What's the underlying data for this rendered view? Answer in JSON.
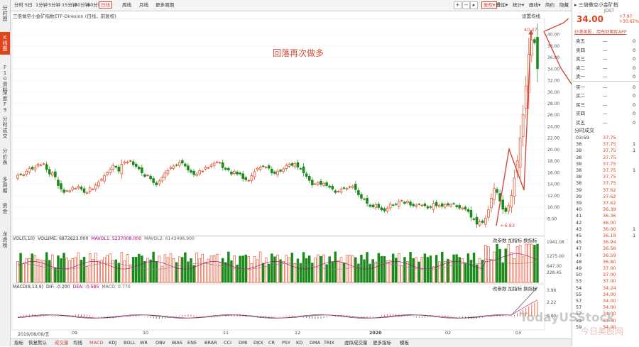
{
  "sidebar": [
    {
      "label": "分时图",
      "active": false
    },
    {
      "label": "K线图",
      "active": true
    },
    {
      "label": "F10资料",
      "active": false
    },
    {
      "label": "深度F9",
      "active": false
    },
    {
      "label": "分时成交",
      "active": false
    },
    {
      "label": "分价表",
      "active": false
    },
    {
      "label": "多周期",
      "active": false
    },
    {
      "label": "资金",
      "active": false
    },
    {
      "label": "龙虎榜",
      "active": false
    }
  ],
  "toolbar": {
    "periods": [
      "分时",
      "5日",
      "1分钟",
      "5分钟",
      "15分钟",
      "30分钟",
      "60分钟",
      "日线",
      "周线",
      "月线",
      "更多周期"
    ],
    "active_period": "日线",
    "nav_btns": [
      "+",
      "−",
      "▸"
    ],
    "fq": "复权",
    "right_items": [
      "叠加",
      "统计",
      "画线",
      "简约",
      "隐藏"
    ]
  },
  "chart": {
    "title": "三倍做空小金矿指数ETF-Direxion (日线，前复权)",
    "settings": "设置均线",
    "annotation": "回落再次做多",
    "high_label": "40.47",
    "low_label": "6.83",
    "y_ticks": [
      "40.00",
      "38.00",
      "36.00",
      "34.00",
      "32.00",
      "30.00",
      "28.00",
      "26.00",
      "24.00",
      "22.00",
      "20.00",
      "18.00",
      "16.00",
      "14.00",
      "12.00",
      "10.00",
      "8.00"
    ]
  },
  "volume": {
    "label": "VOL(5,10)",
    "volume": "VOLUME: 6872623.000",
    "ma1": "MAVOL1: 5237008.000",
    "ma2": "MAVOL2: 6143496.900",
    "ticks": [
      "1941.08",
      "1275.00",
      "647.00",
      "228.45"
    ],
    "buttons": [
      "改参数",
      "加指标",
      "换指标"
    ]
  },
  "macd": {
    "label": "MACD(8,13,9)",
    "dif": "DIF: -0.200",
    "dea": "DEA: -0.585",
    "macd": "MACD: 0.770",
    "ticks": [
      "3.96",
      "2.22",
      "0.00"
    ],
    "buttons": [
      "改参数",
      "加指标",
      "换指标"
    ]
  },
  "xaxis": [
    "2019/08/09/五",
    "09",
    "10",
    "11",
    "12",
    "2020",
    "02",
    "03"
  ],
  "bottom_tabs": [
    "指标",
    "恢复默认",
    "成交量",
    "均线",
    "MACD",
    "KDJ",
    "BOLL",
    "WR",
    "OBV",
    "BIAS",
    "ENE",
    "BRAR",
    "CCI",
    "DMI",
    "DKX",
    "CR",
    "PSY",
    "KD",
    "DMA",
    "TRIX",
    "虚拟成交量",
    "更多指标",
    "模板"
  ],
  "quote": {
    "name": "三倍做空小金矿指",
    "code": "JDST",
    "price": "34.00",
    "change": "+7.97",
    "change_pct": "+30.62%",
    "notice": "炒港美股，用东财国际APP",
    "sells": [
      "卖五",
      "卖四",
      "卖三",
      "卖二",
      "卖一"
    ],
    "buys": [
      "买一",
      "买二",
      "买三",
      "买四",
      "买五"
    ],
    "dash": "—",
    "zero": "0"
  },
  "trades_title": "分时成交",
  "trades": [
    {
      "t": "03:59",
      "p": "37.75",
      "v": ""
    },
    {
      "t": "38",
      "p": "37.75",
      "v": "1"
    },
    {
      "t": "38",
      "p": "37.75",
      "v": "1"
    },
    {
      "t": "38",
      "p": "37.75",
      "v": ""
    },
    {
      "t": "38",
      "p": "37.75",
      "v": ""
    },
    {
      "t": "38",
      "p": "37.75",
      "v": "1"
    },
    {
      "t": "38",
      "p": "37.75",
      "v": ""
    },
    {
      "t": "38",
      "p": "37.75",
      "v": ""
    },
    {
      "t": "39",
      "p": "37.62",
      "v": ""
    },
    {
      "t": "39",
      "p": "37.62",
      "v": ""
    },
    {
      "t": "39",
      "p": "37.62",
      "v": ""
    },
    {
      "t": "40",
      "p": "36.39",
      "v": ""
    },
    {
      "t": "41",
      "p": "36.36",
      "v": ""
    },
    {
      "t": "42",
      "p": "36.00",
      "v": ""
    },
    {
      "t": "43",
      "p": "36.00",
      "v": "1"
    },
    {
      "t": "45",
      "p": "36.19",
      "v": "1"
    },
    {
      "t": "45",
      "p": "36.94",
      "v": ""
    },
    {
      "t": "47",
      "p": "36.56",
      "v": ""
    },
    {
      "t": "47",
      "p": "36.59",
      "v": ""
    },
    {
      "t": "48",
      "p": "36.80",
      "v": ""
    },
    {
      "t": "49",
      "p": "37.00",
      "v": ""
    },
    {
      "t": "50",
      "p": "37.00",
      "v": ""
    },
    {
      "t": "53",
      "p": "37.00",
      "v": ""
    },
    {
      "t": "54",
      "p": "34.24",
      "v": ""
    },
    {
      "t": "55",
      "p": "34.00",
      "v": ""
    },
    {
      "t": "57",
      "p": "34.00",
      "v": ""
    },
    {
      "t": "57",
      "p": "34.00",
      "v": ""
    },
    {
      "t": "57",
      "p": "34.00",
      "v": ""
    },
    {
      "t": "59",
      "p": "34.50",
      "v": ""
    },
    {
      "t": "59",
      "p": "34.00",
      "v": ""
    }
  ],
  "colors": {
    "up": "#e0441b",
    "down": "#1a8a1a",
    "accent": "#d04a3b",
    "ma1": "#b0007a",
    "ma2": "#888888"
  },
  "watermark": "TodayUSStock",
  "watermark_sub": "今日美股网",
  "chart_data": {
    "type": "candlestick",
    "ylim": [
      6,
      41
    ],
    "yticks": [
      8,
      10,
      12,
      14,
      16,
      18,
      20,
      22,
      24,
      26,
      28,
      30,
      32,
      34,
      36,
      38,
      40
    ],
    "closes": [
      15.5,
      15.6,
      15.6,
      16.2,
      16.7,
      16.6,
      16.9,
      17.4,
      17.3,
      17.5,
      16.5,
      15.7,
      15.9,
      15.2,
      13.7,
      13.1,
      12.5,
      12.8,
      12.8,
      13.4,
      13.2,
      13.6,
      13.1,
      12.5,
      12.5,
      13.3,
      13.1,
      13.8,
      14.3,
      14.8,
      15.4,
      15.9,
      16.5,
      17.2,
      16.9,
      16.2,
      17.4,
      17.8,
      17.8,
      18.0,
      17.3,
      17.0,
      16.6,
      15.9,
      15.3,
      15.5,
      14.9,
      14.2,
      13.8,
      14.5,
      15.1,
      15.9,
      16.3,
      16.9,
      17.1,
      17.2,
      17.8,
      17.6,
      17.1,
      16.4,
      16.0,
      15.6,
      15.7,
      16.3,
      16.2,
      16.9,
      16.8,
      17.3,
      17.6,
      17.8,
      17.7,
      16.8,
      16.5,
      16.4,
      15.7,
      16.2,
      15.7,
      15.7,
      14.9,
      14.7,
      14.6,
      15.4,
      16.1,
      16.7,
      16.9,
      17.0,
      16.9,
      16.7,
      15.9,
      15.8,
      16.2,
      16.2,
      16.6,
      17.2,
      17.4,
      17.2,
      17.5,
      16.9,
      16.6,
      15.9,
      15.3,
      14.6,
      13.8,
      14.0,
      14.2,
      13.9,
      14.1,
      13.7,
      13.4,
      13.1,
      12.5,
      12.7,
      13.1,
      13.2,
      13.2,
      13.5,
      13.6,
      13.0,
      12.1,
      11.5,
      11.3,
      10.6,
      10.1,
      10.0,
      10.4,
      9.9,
      9.5,
      9.3,
      9.8,
      10.5,
      10.3,
      10.4,
      10.9,
      11.1,
      10.6,
      11.0,
      10.3,
      10.2,
      10.3,
      10.4,
      10.3,
      10.2,
      9.8,
      9.9,
      10.6,
      10.2,
      10.3,
      10.1,
      10.4,
      10.3,
      10.4,
      10.5,
      10.0,
      9.8,
      9.8,
      9.6,
      9.2,
      8.2,
      7.8,
      7.0,
      7.4,
      7.3,
      8.0,
      9.5,
      11.5,
      13.2,
      12.5,
      11.0,
      9.6,
      9.2,
      10.2,
      12.0,
      15.0,
      18.0,
      22.0,
      26.0,
      31.0,
      36.5,
      39.0,
      38.5,
      34.0
    ],
    "volume_ticks": [
      1941.08,
      1275.0,
      647.0,
      228.45
    ],
    "macd_ticks": [
      3.96,
      2.22,
      0.0
    ],
    "xlabels": [
      "2019/08/09/五",
      "09",
      "10",
      "11",
      "12",
      "2020",
      "02",
      "03"
    ],
    "high": 40.47,
    "low": 6.83
  }
}
